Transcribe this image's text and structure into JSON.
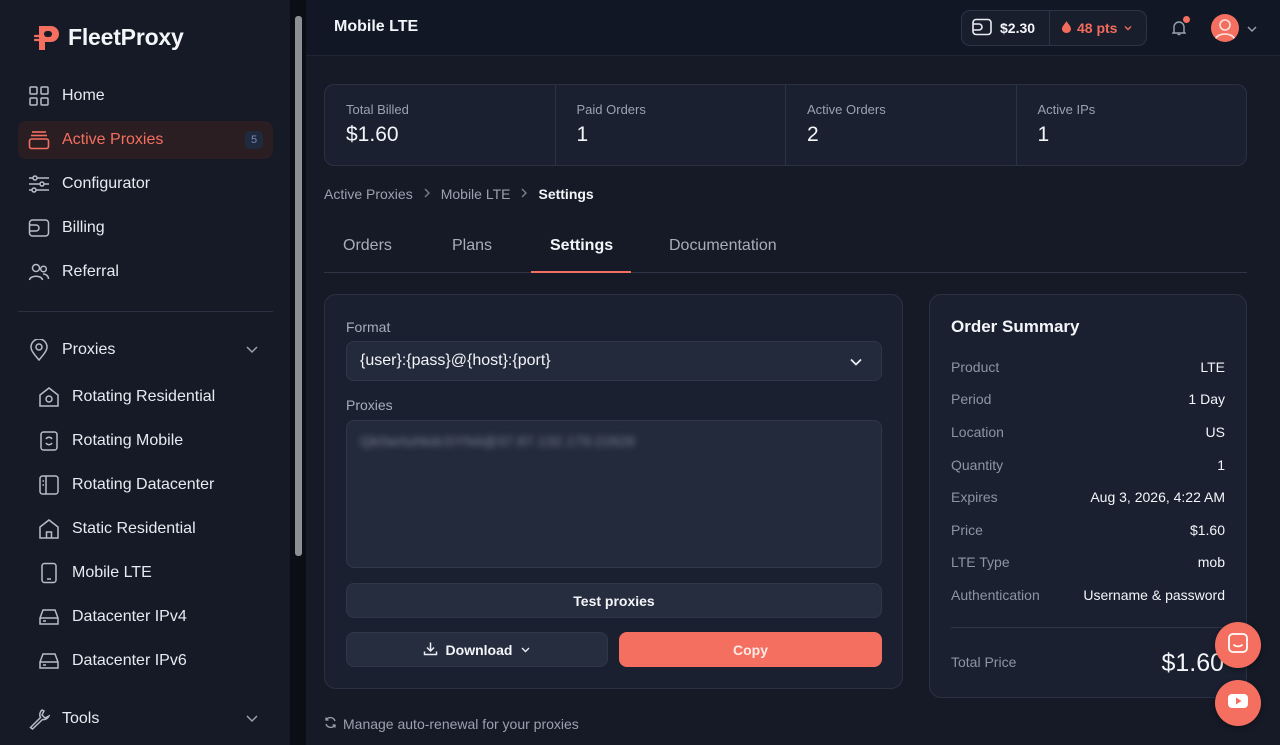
{
  "brand": {
    "name": "FleetProxy",
    "accent": "#f46f5f"
  },
  "sidebar": {
    "items": [
      {
        "label": "Home",
        "icon": "grid-icon"
      },
      {
        "label": "Active Proxies",
        "icon": "inbox-icon",
        "badge": "5",
        "active": true
      },
      {
        "label": "Configurator",
        "icon": "sliders-icon"
      },
      {
        "label": "Billing",
        "icon": "wallet-icon"
      },
      {
        "label": "Referral",
        "icon": "users-icon"
      }
    ],
    "proxies_section": {
      "label": "Proxies",
      "icon": "map-pin-icon",
      "items": [
        {
          "label": "Rotating Residential",
          "icon": "house-rotate-icon"
        },
        {
          "label": "Rotating Mobile",
          "icon": "phone-rotate-icon"
        },
        {
          "label": "Rotating Datacenter",
          "icon": "server-panel-icon"
        },
        {
          "label": "Static Residential",
          "icon": "house-icon"
        },
        {
          "label": "Mobile LTE",
          "icon": "smartphone-icon"
        },
        {
          "label": "Datacenter IPv4",
          "icon": "drive-icon"
        },
        {
          "label": "Datacenter IPv6",
          "icon": "drive-icon"
        }
      ]
    },
    "tools_section": {
      "label": "Tools",
      "icon": "wrench-icon"
    }
  },
  "header": {
    "title": "Mobile LTE",
    "balance": "$2.30",
    "points": "48 pts"
  },
  "stats": [
    {
      "label": "Total Billed",
      "value": "$1.60"
    },
    {
      "label": "Paid Orders",
      "value": "1"
    },
    {
      "label": "Active Orders",
      "value": "2"
    },
    {
      "label": "Active IPs",
      "value": "1"
    }
  ],
  "breadcrumb": [
    "Active Proxies",
    "Mobile LTE",
    "Settings"
  ],
  "tabs": [
    "Orders",
    "Plans",
    "Settings",
    "Documentation"
  ],
  "active_tab": "Settings",
  "settings": {
    "format_label": "Format",
    "format_value": "{user}:{pass}@{host}:{port}",
    "proxies_label": "Proxies",
    "proxies_value": "Qk0wrtuhkdcSYN4@37.87.132.179:22626",
    "test_button": "Test proxies",
    "download_button": "Download",
    "copy_button": "Copy",
    "autorenew_link": "Manage auto-renewal for your proxies"
  },
  "summary": {
    "title": "Order Summary",
    "rows": [
      {
        "k": "Product",
        "v": "LTE"
      },
      {
        "k": "Period",
        "v": "1 Day"
      },
      {
        "k": "Location",
        "v": "US"
      },
      {
        "k": "Quantity",
        "v": "1"
      },
      {
        "k": "Expires",
        "v": "Aug 3, 2026, 4:22 AM"
      },
      {
        "k": "Price",
        "v": "$1.60"
      },
      {
        "k": "LTE Type",
        "v": "mob"
      },
      {
        "k": "Authentication",
        "v": "Username & password"
      }
    ],
    "total_label": "Total Price",
    "total_value": "$1.60"
  }
}
